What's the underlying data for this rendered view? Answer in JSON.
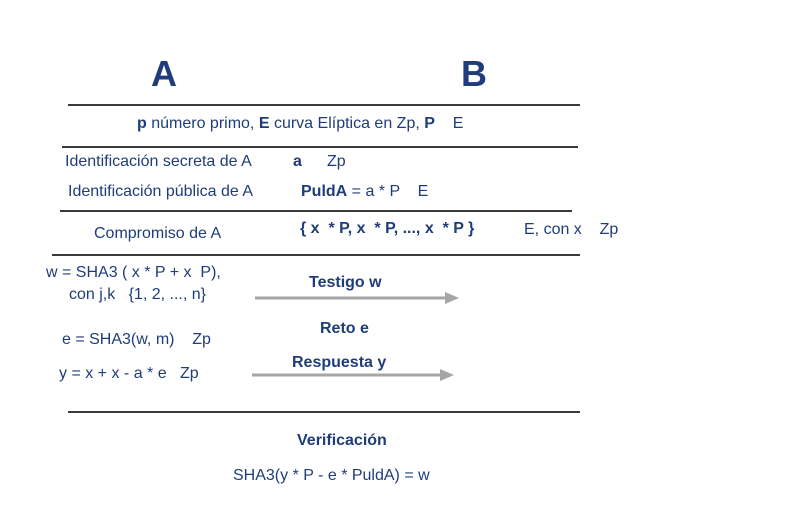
{
  "parties": {
    "a": "A",
    "b": "B"
  },
  "params": {
    "p": "p",
    "t1": " número primo, ",
    "e": "E",
    "t2": " curva Elíptica en Zp, ",
    "pp": "P",
    "t3": "    E"
  },
  "secret": {
    "label": "Identificación secreta de A",
    "var": "a",
    "set": "Zp"
  },
  "public": {
    "label": "Identificación pública de A",
    "var": "PuldA",
    "rest": " = a * P    E"
  },
  "commit": {
    "label": "Compromiso de A",
    "set": "{ x  * P, x  * P, ..., x  * P }",
    "rest": "E, con x    Zp"
  },
  "witness": {
    "line1": "w = SHA3 ( x * P + x  P),",
    "line2": "con j,k   {1, 2, ..., n}",
    "arrow_label": "Testigo w"
  },
  "challenge": {
    "label": "Reto e",
    "formula": "e = SHA3(w, m)    Zp"
  },
  "response": {
    "formula": "y = x + x - a * e   Zp",
    "arrow_label": "Respuesta y"
  },
  "verification": {
    "title": "Verificación",
    "formula": "SHA3(y * P - e * PuldA) = w"
  },
  "colors": {
    "text": "#1f3d7a",
    "rule": "#3a3a3a",
    "arrow": "#a6a6a6"
  }
}
